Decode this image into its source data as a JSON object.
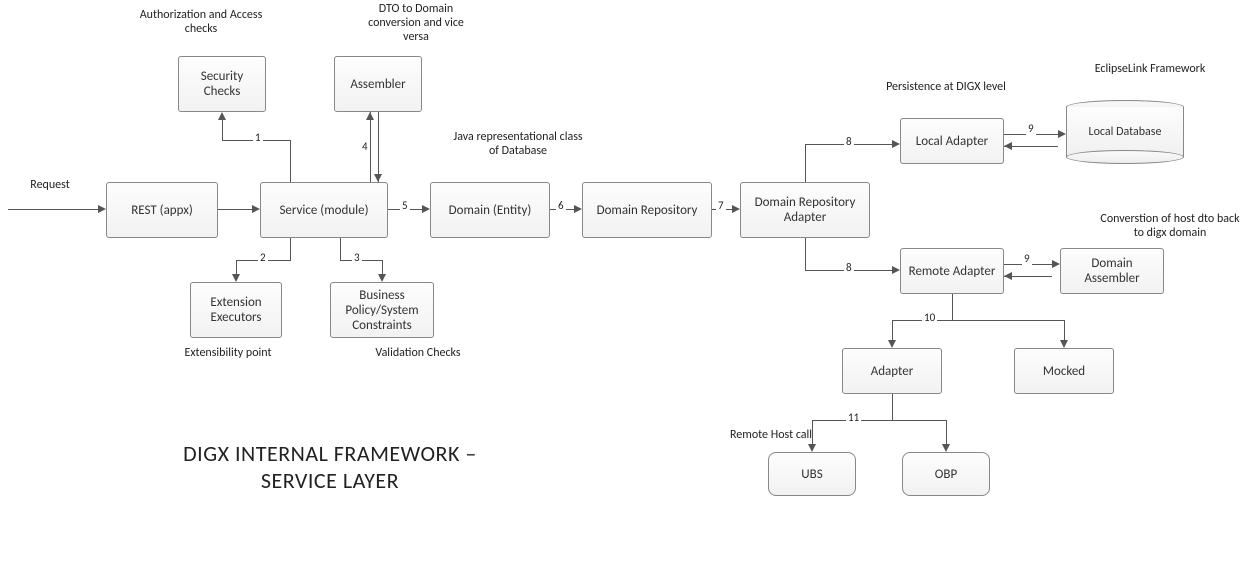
{
  "title": "DIGX INTERNAL FRAMEWORK – SERVICE LAYER",
  "labels": {
    "request": "Request",
    "auth": "Authorization and Access checks",
    "dto": "DTO to Domain conversion and vice versa",
    "javaRep": "Java representational class of Database",
    "persistence": "Persistence at DIGX level",
    "eclipselink": "EclipseLink Framework",
    "extensibility": "Extensibility point",
    "validation": "Validation Checks",
    "conversion": "Converstion of host dto back to digx domain",
    "remoteHost": "Remote Host call"
  },
  "nodes": {
    "rest": "REST (appx)",
    "service": "Service (module)",
    "security": "Security Checks",
    "assembler": "Assembler",
    "domain": "Domain (Entity)",
    "domainRepo": "Domain Repository",
    "domainRepoAdapter": "Domain Repository Adapter",
    "localAdapter": "Local Adapter",
    "localDb": "Local Database",
    "remoteAdapter": "Remote Adapter",
    "domainAssembler": "Domain Assembler",
    "extExec": "Extension Executors",
    "bizPolicy": "Business Policy/System Constraints",
    "adapter": "Adapter",
    "mocked": "Mocked",
    "ubs": "UBS",
    "obp": "OBP"
  },
  "edges": {
    "e1": "1",
    "e2": "2",
    "e3": "3",
    "e4": "4",
    "e5": "5",
    "e6": "6",
    "e7": "7",
    "e8a": "8",
    "e8b": "8",
    "e9a": "9",
    "e9b": "9",
    "e10": "10",
    "e11": "11"
  }
}
